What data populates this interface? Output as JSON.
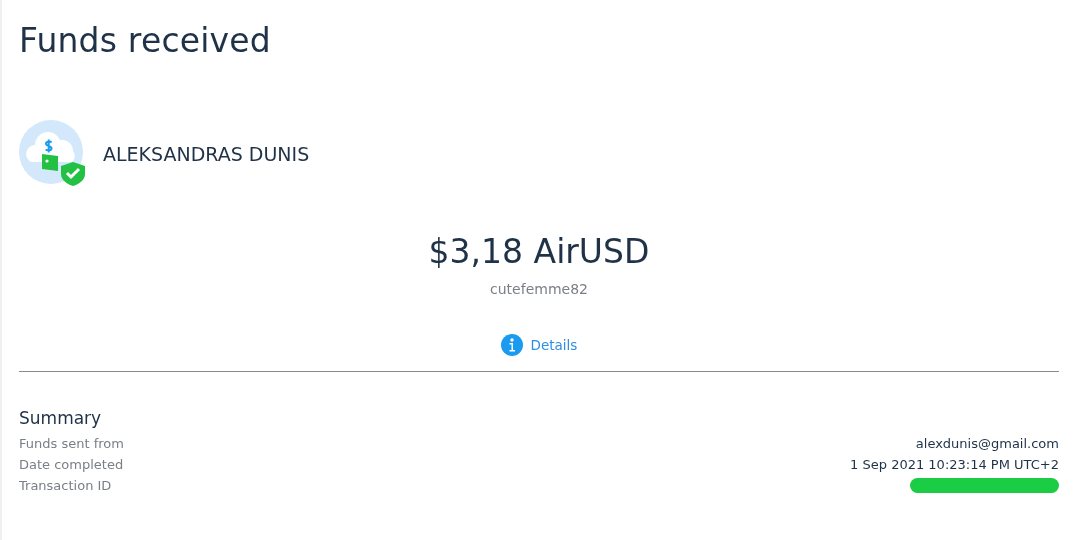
{
  "page": {
    "title": "Funds received"
  },
  "recipient": {
    "name": "ALEKSANDRAS DUNIS"
  },
  "amount": {
    "value": "$3,18 AirUSD",
    "username": "cutefemme82"
  },
  "details_link": {
    "label": "Details"
  },
  "summary": {
    "title": "Summary",
    "rows": [
      {
        "label": "Funds sent from",
        "kind": "text",
        "value": "alexdunis@gmail.com"
      },
      {
        "label": "Date completed",
        "kind": "text",
        "value": "1 Sep 2021 10:23:14 PM UTC+2"
      },
      {
        "label": "Transaction ID",
        "kind": "redacted"
      }
    ]
  }
}
